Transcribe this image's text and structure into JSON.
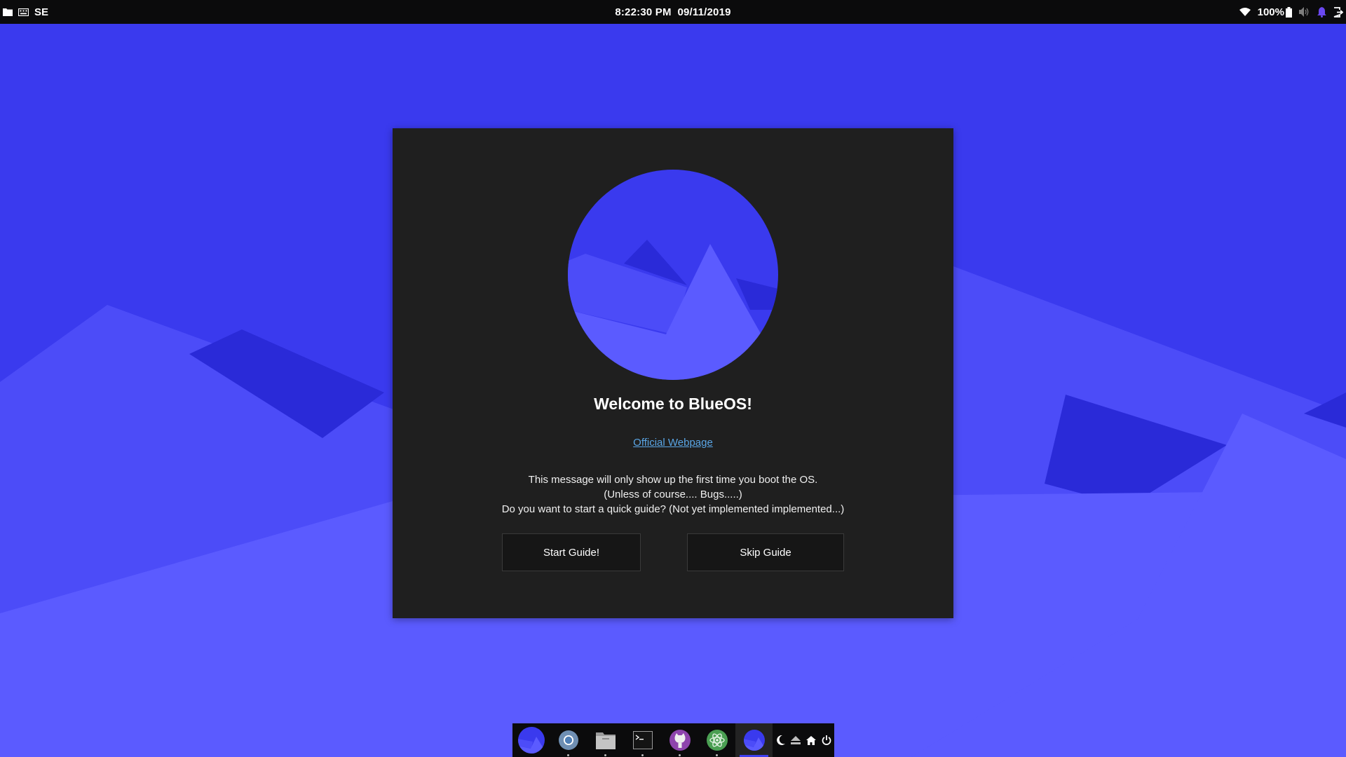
{
  "topbar": {
    "left_icons": [
      "folder-icon",
      "keyboard-icon"
    ],
    "keyboard_layout": "SE",
    "time": "8:22:30 PM",
    "date": "09/11/2019",
    "battery_percent": "100%",
    "right_icons": [
      "wifi-icon",
      "battery-icon",
      "volume-icon",
      "notification-bell-icon",
      "logout-icon"
    ]
  },
  "dialog": {
    "title": "Welcome to BlueOS!",
    "link_text": "Official Webpage",
    "message_lines": [
      "This message will only show up the first time you boot the OS.",
      "(Unless of course.... Bugs.....)",
      "Do you want to start a quick guide? (Not yet implemented implemented...)"
    ],
    "start_button": "Start Guide!",
    "skip_button": "Skip Guide"
  },
  "dock": {
    "apps": [
      {
        "name": "blueos-launcher-icon",
        "running": false,
        "active": false
      },
      {
        "name": "chromium-browser-icon",
        "running": true,
        "active": false
      },
      {
        "name": "file-manager-icon",
        "running": true,
        "active": false
      },
      {
        "name": "terminal-icon",
        "running": true,
        "active": false
      },
      {
        "name": "github-desktop-icon",
        "running": true,
        "active": false
      },
      {
        "name": "atom-editor-icon",
        "running": true,
        "active": false
      },
      {
        "name": "blueos-welcome-icon",
        "running": false,
        "active": true
      }
    ],
    "system_icons": [
      "night-mode-icon",
      "eject-icon",
      "home-icon",
      "power-icon"
    ]
  },
  "colors": {
    "wallpaper_sky": "#3a3aee",
    "wallpaper_mid": "#4b4bf6",
    "wallpaper_dark": "#2a2ad8",
    "wallpaper_light": "#5d5dfe",
    "dialog_bg": "#1f1f1f",
    "link": "#5aa6e6",
    "accent": "#3f3fee"
  }
}
